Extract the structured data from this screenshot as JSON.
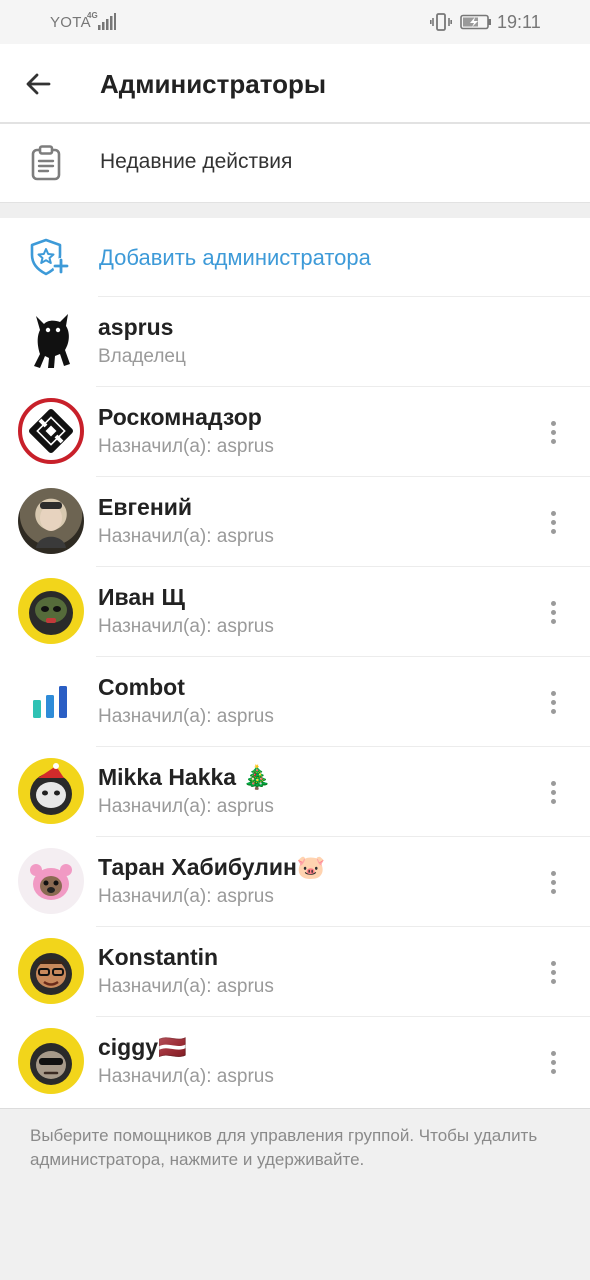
{
  "status_bar": {
    "carrier": "YOTA",
    "network": "4G",
    "time": "19:11",
    "icons": [
      "signal-icon",
      "vibrate-icon",
      "battery-charging-icon"
    ]
  },
  "toolbar": {
    "back_icon": "arrow-left-icon",
    "title": "Администраторы"
  },
  "recent_actions": {
    "icon": "clipboard-icon",
    "label": "Недавние действия"
  },
  "add_admin": {
    "icon": "shield-star-plus-icon",
    "label": "Добавить администратора",
    "accent_color": "#3d9ad8"
  },
  "admins": [
    {
      "name": "asprus",
      "role": "Владелец",
      "avatar": "black-cat-avatar",
      "has_menu": false
    },
    {
      "name": "Роскомнадзор",
      "role": "Назначил(а): asprus",
      "avatar": "roskomnadzor-logo-avatar",
      "has_menu": true
    },
    {
      "name": "Евгений",
      "role": "Назначил(а): asprus",
      "avatar": "photo-avatar",
      "has_menu": true
    },
    {
      "name": "Иван Щ",
      "role": "Назначил(а): asprus",
      "avatar": "helmet-avatar",
      "has_menu": true
    },
    {
      "name": "Combot",
      "role": "Назначил(а): asprus",
      "avatar": "bar-chart-logo-avatar",
      "has_menu": true
    },
    {
      "name": "Mikka Hakka 🎄",
      "role": "Назначил(а): asprus",
      "avatar": "santa-cat-avatar",
      "has_menu": true
    },
    {
      "name": "Таран Хабибулин🐷",
      "role": "Назначил(а): asprus",
      "avatar": "pink-pig-dog-avatar",
      "has_menu": true
    },
    {
      "name": "Konstantin",
      "role": "Назначил(а): asprus",
      "avatar": "cartoon-face-avatar",
      "has_menu": true
    },
    {
      "name": "ciggy🇱🇻",
      "role": "Назначил(а): asprus",
      "avatar": "sunglasses-face-avatar",
      "has_menu": true
    }
  ],
  "footer_note": "Выберите помощников для управления группой. Чтобы удалить администратора, нажмите и удерживайте."
}
